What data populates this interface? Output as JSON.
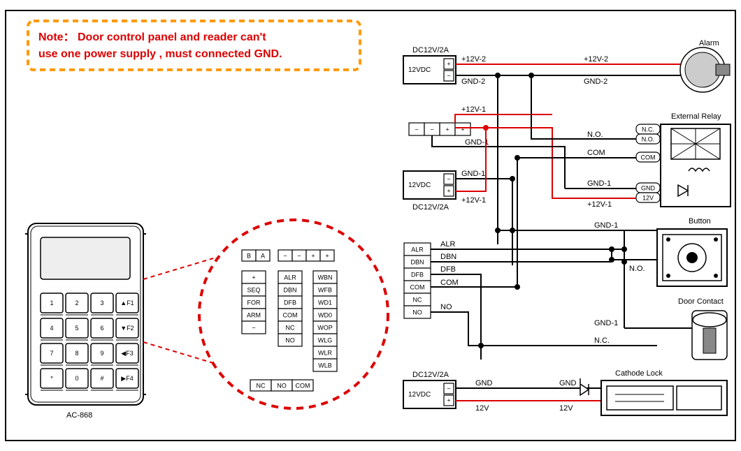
{
  "note_line1": "Note： Door control panel and  reader can't",
  "note_line2": "use one power supply , must connected GND.",
  "device_model": "AC-868",
  "keypad": {
    "rows": [
      [
        "1",
        "2",
        "3",
        "▲F1"
      ],
      [
        "4",
        "5",
        "6",
        "▼F2"
      ],
      [
        "7",
        "8",
        "9",
        "◀F3"
      ],
      [
        "*",
        "0",
        "#",
        "▶F4"
      ]
    ]
  },
  "detail": {
    "top_ba": [
      "B",
      "A"
    ],
    "top_pm": [
      "−",
      "−",
      "+",
      "+"
    ],
    "left_col": [
      "+",
      "SEQ",
      "FOR",
      "ARM",
      "−"
    ],
    "mid_col": [
      "ALR",
      "DBN",
      "DFB",
      "COM",
      "NC",
      "NO"
    ],
    "right_col": [
      "WBN",
      "WFB",
      "WD1",
      "WD0",
      "WOP",
      "WLG",
      "WLR",
      "WLB"
    ],
    "bottom": [
      "NC",
      "NO",
      "COM"
    ]
  },
  "right_diagram": {
    "psu_label": "12VDC",
    "psu_spec": "DC12V/2A",
    "alarm_label": "Alarm",
    "relay_label": "External Relay",
    "relay_pins": [
      "N.C.",
      "N.O.",
      "COM",
      "GND",
      "12V"
    ],
    "button_label": "Button",
    "door_contact_label": "Door Contact",
    "cathode_lock_label": "Cathode Lock",
    "terminals_top": [
      "−",
      "−",
      "+",
      "+"
    ],
    "conn_block": [
      "ALR",
      "DBN",
      "DFB",
      "COM",
      "NC",
      "NO"
    ],
    "wire_labels": {
      "p12v2": "+12V-2",
      "gnd2": "GND-2",
      "p12v1": "+12V-1",
      "gnd1": "GND-1",
      "no": "N.O.",
      "com": "COM",
      "nc": "N.C.",
      "alr": "ALR",
      "dbn": "DBN",
      "dfb": "DFB",
      "no2": "NO",
      "gnd": "GND",
      "v12": "12V"
    }
  }
}
